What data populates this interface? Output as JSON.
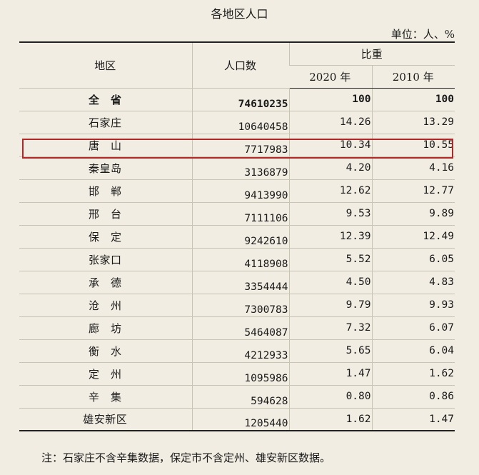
{
  "title": "各地区人口",
  "unit": "单位：人、%",
  "headers": {
    "region": "地区",
    "population": "人口数",
    "share": "比重",
    "year2020": "2020 年",
    "year2010": "2010 年"
  },
  "rows": [
    {
      "region": "全　省",
      "population": "74610235",
      "p2020": "100",
      "p2010": "100",
      "total": true
    },
    {
      "region": "石家庄",
      "population": "10640458",
      "p2020": "14.26",
      "p2010": "13.29"
    },
    {
      "region": "唐　山",
      "population": "7717983",
      "p2020": "10.34",
      "p2010": "10.55",
      "highlighted": true
    },
    {
      "region": "秦皇岛",
      "population": "3136879",
      "p2020": "4.20",
      "p2010": "4.16"
    },
    {
      "region": "邯　郸",
      "population": "9413990",
      "p2020": "12.62",
      "p2010": "12.77"
    },
    {
      "region": "邢　台",
      "population": "7111106",
      "p2020": "9.53",
      "p2010": "9.89"
    },
    {
      "region": "保　定",
      "population": "9242610",
      "p2020": "12.39",
      "p2010": "12.49"
    },
    {
      "region": "张家口",
      "population": "4118908",
      "p2020": "5.52",
      "p2010": "6.05"
    },
    {
      "region": "承　德",
      "population": "3354444",
      "p2020": "4.50",
      "p2010": "4.83"
    },
    {
      "region": "沧　州",
      "population": "7300783",
      "p2020": "9.79",
      "p2010": "9.93"
    },
    {
      "region": "廊　坊",
      "population": "5464087",
      "p2020": "7.32",
      "p2010": "6.07"
    },
    {
      "region": "衡　水",
      "population": "4212933",
      "p2020": "5.65",
      "p2010": "6.04"
    },
    {
      "region": "定　州",
      "population": "1095986",
      "p2020": "1.47",
      "p2010": "1.62"
    },
    {
      "region": "辛　集",
      "population": "594628",
      "p2020": "0.80",
      "p2010": "0.86"
    },
    {
      "region": "雄安新区",
      "population": "1205440",
      "p2020": "1.62",
      "p2010": "1.47"
    }
  ],
  "note": "注：石家庄不含辛集数据，保定市不含定州、雄安新区数据。",
  "highlight_color": "#b52626"
}
